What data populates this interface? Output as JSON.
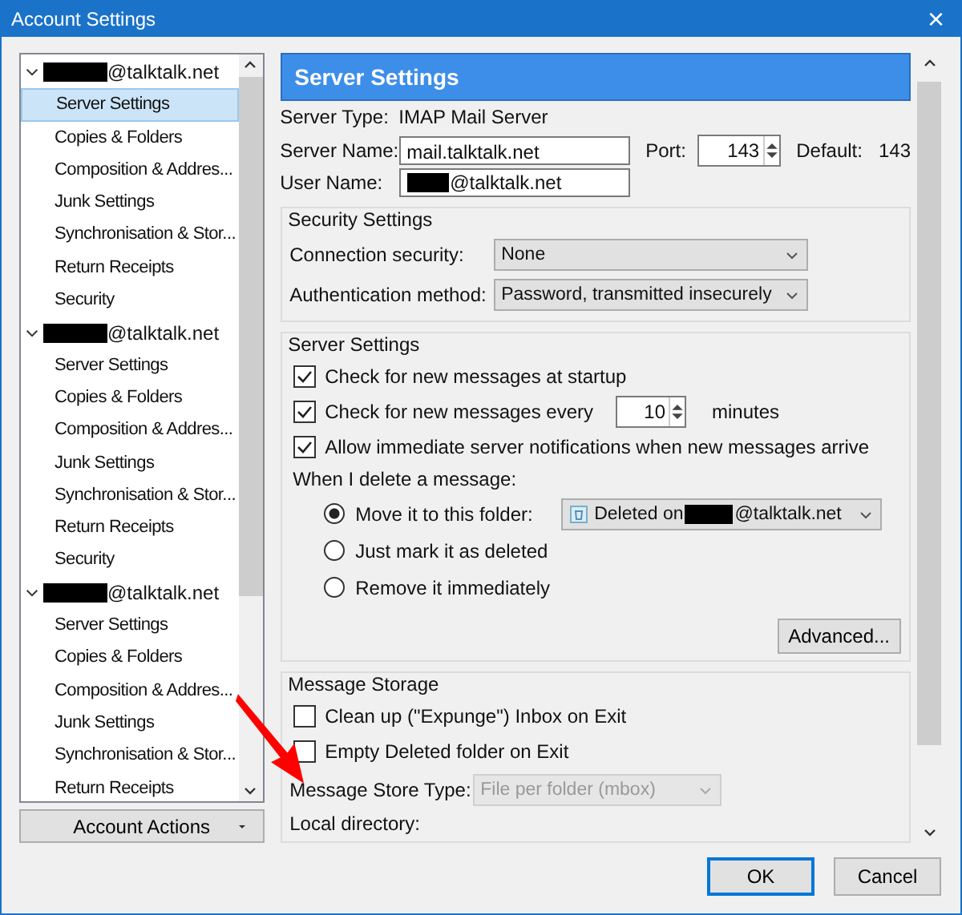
{
  "window": {
    "title": "Account Settings",
    "close": "×"
  },
  "sidebar": {
    "accounts": [
      {
        "name": "@talktalk.net",
        "expanded": true,
        "children": [
          {
            "label": "Server Settings",
            "selected": true
          },
          {
            "label": "Copies & Folders",
            "selected": false
          },
          {
            "label": "Composition & Addres...",
            "selected": false
          },
          {
            "label": "Junk Settings",
            "selected": false
          },
          {
            "label": "Synchronisation & Stor...",
            "selected": false
          },
          {
            "label": "Return Receipts",
            "selected": false
          },
          {
            "label": "Security",
            "selected": false
          }
        ]
      },
      {
        "name": "@talktalk.net",
        "expanded": true,
        "children": [
          {
            "label": "Server Settings",
            "selected": false
          },
          {
            "label": "Copies & Folders",
            "selected": false
          },
          {
            "label": "Composition & Addres...",
            "selected": false
          },
          {
            "label": "Junk Settings",
            "selected": false
          },
          {
            "label": "Synchronisation & Stor...",
            "selected": false
          },
          {
            "label": "Return Receipts",
            "selected": false
          },
          {
            "label": "Security",
            "selected": false
          }
        ]
      },
      {
        "name": "@talktalk.net",
        "expanded": true,
        "children": [
          {
            "label": "Server Settings",
            "selected": false
          },
          {
            "label": "Copies & Folders",
            "selected": false
          },
          {
            "label": "Composition & Addres...",
            "selected": false
          },
          {
            "label": "Junk Settings",
            "selected": false
          },
          {
            "label": "Synchronisation & Stor...",
            "selected": false
          },
          {
            "label": "Return Receipts",
            "selected": false
          }
        ]
      }
    ],
    "actions": "Account Actions"
  },
  "server": {
    "header": "Server Settings",
    "type_label": "Server Type:",
    "type_value": "IMAP Mail Server",
    "name_label": "Server Name:",
    "name_value": "mail.talktalk.net",
    "port_label": "Port:",
    "port_value": "143",
    "default_label": "Default:",
    "default_value": "143",
    "user_label": "User Name:",
    "user_value": "@talktalk.net"
  },
  "security": {
    "title": "Security Settings",
    "rows": [
      {
        "label": "Connection security:",
        "value": "None"
      },
      {
        "label": "Authentication method:",
        "value": "Password, transmitted insecurely"
      }
    ]
  },
  "checks": {
    "title": "Server Settings",
    "items": [
      {
        "kind": "plain",
        "label": "Check for new messages at startup",
        "checked": true
      },
      {
        "kind": "interval",
        "label": "Check for new messages every",
        "value": "10",
        "unit": "minutes",
        "checked": true
      },
      {
        "kind": "plain",
        "label": "Allow immediate server notifications when new messages arrive",
        "checked": true
      }
    ],
    "delete_label": "When I delete a message:",
    "radios": [
      {
        "label": "Move it to this folder:",
        "selected": true,
        "folder": "Deleted on",
        "folder_account": "@talktalk.net"
      },
      {
        "label": "Just mark it as deleted",
        "selected": false
      },
      {
        "label": "Remove it immediately",
        "selected": false
      }
    ],
    "advanced": "Advanced..."
  },
  "storage": {
    "title": "Message Storage",
    "items": [
      {
        "label": "Clean up (\"Expunge\") Inbox on Exit",
        "checked": false
      },
      {
        "label": "Empty Deleted folder on Exit",
        "checked": false
      }
    ],
    "store_label": "Message Store Type:",
    "store_value": "File per folder (mbox)",
    "store_disabled": true,
    "local_label": "Local directory:"
  },
  "buttons": [
    {
      "label": "OK",
      "default": true
    },
    {
      "label": "Cancel",
      "default": false
    }
  ]
}
